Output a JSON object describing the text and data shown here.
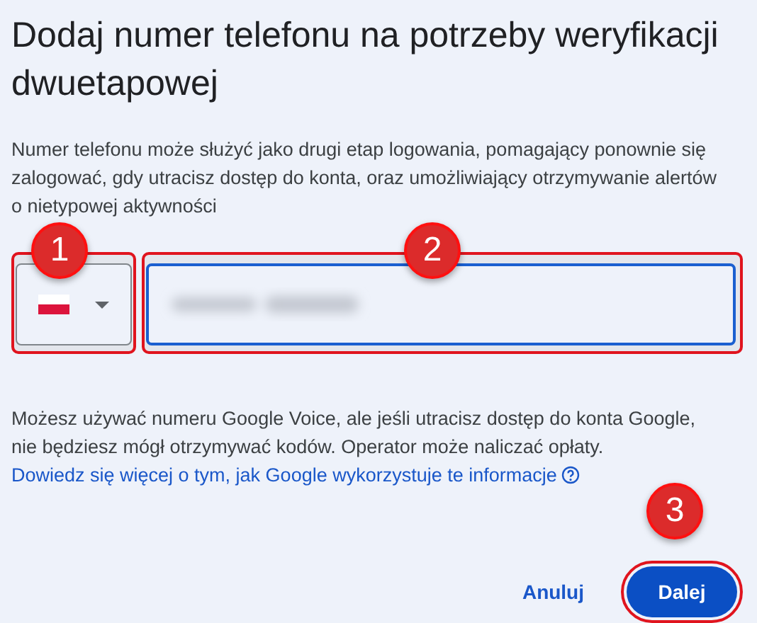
{
  "title": "Dodaj numer telefonu na potrzeby weryfikacji dwuetapowej",
  "description": "Numer telefonu może służyć jako drugi etap logowania, pomagający ponownie się zalogować, gdy utracisz dostęp do konta, oraz umożliwiający otrzymywanie alertów o nietypowej aktywności",
  "phone_field": {
    "focused": true
  },
  "note": "Możesz używać numeru Google Voice, ale jeśli utracisz dostęp do konta Google, nie będziesz mógł otrzymywać kodów. Operator może naliczać opłaty.",
  "link": "Dowiedz się więcej o tym, jak Google wykorzystuje te informacje",
  "buttons": [
    {
      "label": "Anuluj",
      "kind": "text"
    },
    {
      "label": "Dalej",
      "kind": "filled"
    }
  ],
  "annotations": [
    {
      "number": "1"
    },
    {
      "number": "2"
    },
    {
      "number": "3"
    }
  ]
}
